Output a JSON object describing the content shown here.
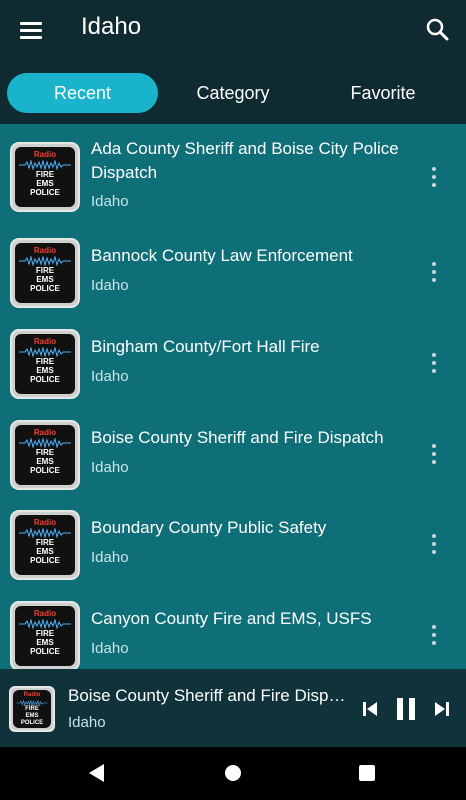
{
  "app": {
    "title": "Idaho"
  },
  "tabs": [
    {
      "label": "Recent",
      "active": true
    },
    {
      "label": "Category",
      "active": false
    },
    {
      "label": "Favorite",
      "active": false
    }
  ],
  "thumb": {
    "line1": "Radio",
    "line2": "FIRE",
    "line3": "EMS",
    "line4": "POLICE"
  },
  "stations": [
    {
      "title": "Ada County Sheriff and Boise City Police Dispatch",
      "subtitle": "Idaho"
    },
    {
      "title": "Bannock County Law Enforcement",
      "subtitle": "Idaho"
    },
    {
      "title": "Bingham County/Fort Hall Fire",
      "subtitle": "Idaho"
    },
    {
      "title": "Boise County Sheriff and Fire Dispatch",
      "subtitle": "Idaho"
    },
    {
      "title": "Boundary County Public Safety",
      "subtitle": "Idaho"
    },
    {
      "title": "Canyon County Fire and EMS, USFS",
      "subtitle": "Idaho"
    }
  ],
  "player": {
    "title": "Boise County Sheriff and Fire Dispatch",
    "subtitle": "Idaho"
  },
  "icons": {
    "menu": "menu-icon",
    "search": "search-icon",
    "more": "more-vert-icon",
    "prev": "skip-previous-icon",
    "pause": "pause-icon",
    "next": "skip-next-icon",
    "back": "nav-back-icon",
    "home": "nav-home-icon",
    "recents": "nav-recents-icon"
  },
  "colors": {
    "background": "#0e6f78",
    "appbar": "#0f2a31",
    "accent": "#19b4cc",
    "player": "#10323a"
  }
}
